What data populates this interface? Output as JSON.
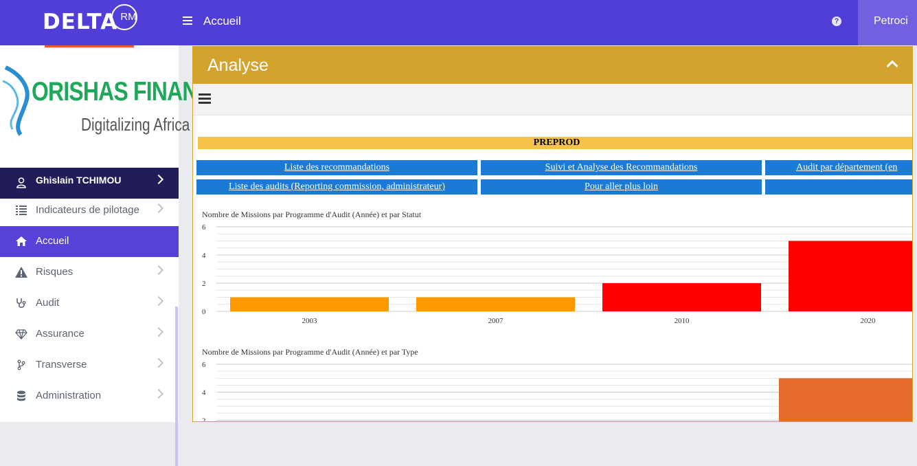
{
  "header": {
    "brand": "DELTA",
    "brand_badge": "RM",
    "page": "Accueil",
    "help_icon": "?",
    "user_name": "Petroci"
  },
  "logo": {
    "name": "ORISHAS FINANCE",
    "tagline": "Digitalizing Africa"
  },
  "sidebar": {
    "user": "Ghislain TCHIMOU",
    "items": [
      {
        "label": "Indicateurs de pilotage",
        "icon": "list-icon"
      },
      {
        "label": "Accueil",
        "icon": "home-icon"
      },
      {
        "label": "Risques",
        "icon": "warning-icon"
      },
      {
        "label": "Audit",
        "icon": "stethoscope-icon"
      },
      {
        "label": "Assurance",
        "icon": "diamond-icon"
      },
      {
        "label": "Transverse",
        "icon": "branch-icon"
      },
      {
        "label": "Administration",
        "icon": "database-icon"
      }
    ]
  },
  "panel": {
    "title": "Analyse",
    "env": "PREPROD",
    "links_row1": [
      "Liste des recommandations",
      "Suivi et Analyse des Recommandations",
      "Audit par département (en"
    ],
    "links_row2": [
      "Liste des audits (Reporting commission, administrateur)",
      "Pour aller plus loin",
      ""
    ]
  },
  "colors": {
    "topbar": "#4f3fd6",
    "panel_header": "#d4a32d",
    "link_button": "#1a7ad6",
    "env_bar": "#f6c24c"
  },
  "chart_data": [
    {
      "type": "bar",
      "title": "Nombre de Missions par Programme d'Audit (Année) et par Statut",
      "categories": [
        "2003",
        "2007",
        "2010",
        "2020"
      ],
      "values": [
        1,
        1,
        2,
        5
      ],
      "colors": [
        "#ff9900",
        "#ff9900",
        "#ff0000",
        "#ff0000"
      ],
      "yticks": [
        "0",
        "2",
        "4",
        "6"
      ],
      "ylim": [
        0,
        6
      ],
      "grid": true
    },
    {
      "type": "bar",
      "title": "Nombre de Missions par Programme d'Audit (Année) et par Type",
      "categories": [],
      "values": [
        5
      ],
      "colors": [
        "#e46a2e"
      ],
      "yticks": [
        "2",
        "4",
        "6"
      ],
      "ylim": [
        0,
        6
      ],
      "grid": true
    }
  ]
}
